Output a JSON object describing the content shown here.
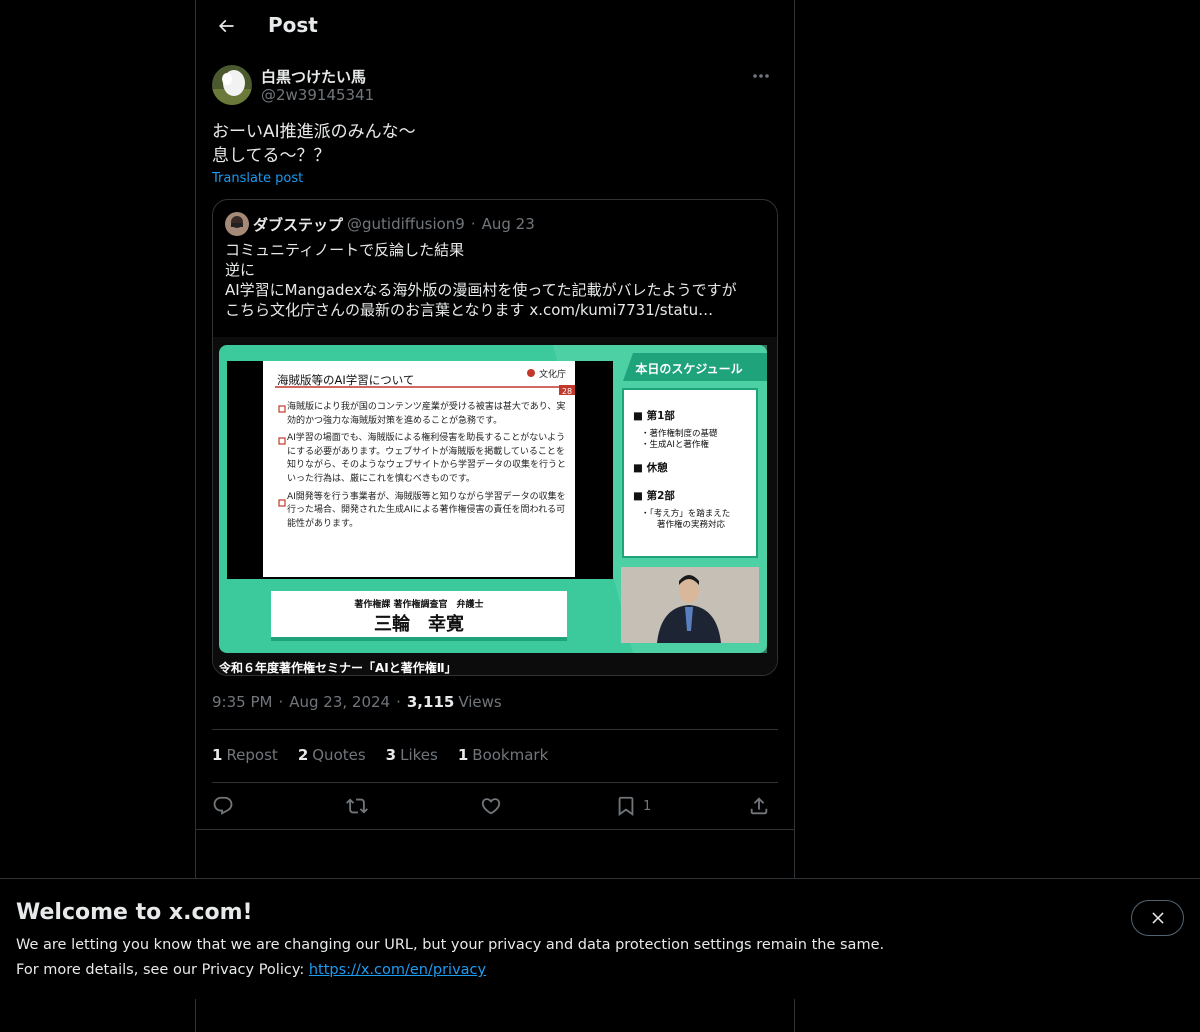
{
  "header": {
    "title": "Post"
  },
  "author": {
    "name": "白黒つけたい馬",
    "handle": "@2w39145341"
  },
  "post": {
    "text": "おーいAI推進派のみんな〜\n息してる〜？？",
    "translate_label": "Translate post"
  },
  "quote": {
    "name": "ダブステップ",
    "handle": "@gutidiffusion9",
    "dot": "·",
    "date": "Aug 23",
    "text": "コミュニティノートで反論した結果\n逆に\nAI学習にMangadexなる海外版の漫画村を使ってた記載がバレたようですが\nこちら文化庁さんの最新のお言葉となります  x.com/kumi7731/statu…",
    "media": {
      "slide_title": "海賊版等のAI学習について",
      "slide_logo": "文化庁",
      "slide_page": "28",
      "slide_bullets": [
        "海賊版により我が国のコンテンツ産業が受ける被害は甚大であり、実効的かつ強力な海賊版対策を進めることが急務です。",
        "AI学習の場面でも、海賊版による権利侵害を助長することがないようにする必要があります。ウェブサイトが海賊版を掲載していることを知りながら、そのようなウェブサイトから学習データの収集を行うといった行為は、厳にこれを慎むべきものです。",
        "AI開発等を行う事業者が、海賊版等と知りながら学習データの収集を行った場合、開発された生成AIによる著作権侵害の責任を問われる可能性があります。"
      ],
      "schedule_title": "本日のスケジュール",
      "schedule_part1": "■ 第1部",
      "schedule_part1_items": [
        "・著作権制度の基礎",
        "・生成AIと著作権"
      ],
      "schedule_break": "■ 休憩",
      "schedule_part2": "■ 第2部",
      "schedule_part2_items": [
        "・「考え方」を踏まえた",
        "著作権の実務対応"
      ],
      "speaker_role": "著作権課 著作権調査官　弁護士",
      "speaker_name": "三輪　幸寛",
      "caption": "令和６年度著作権セミナー「AIと著作権Ⅱ」"
    }
  },
  "meta": {
    "time": "9:35 PM",
    "dot1": "·",
    "date": "Aug 23, 2024",
    "dot2": "·",
    "views_count": "3,115",
    "views_label": "Views"
  },
  "stats": {
    "reposts_count": "1",
    "reposts_label": "Repost",
    "quotes_count": "2",
    "quotes_label": "Quotes",
    "likes_count": "3",
    "likes_label": "Likes",
    "bookmarks_count": "1",
    "bookmarks_label": "Bookmark"
  },
  "actions": {
    "bookmark_count": "1",
    "icons": [
      "reply-icon",
      "repost-icon",
      "like-icon",
      "bookmark-icon",
      "share-icon"
    ]
  },
  "banner": {
    "title": "Welcome to x.com!",
    "line1": "We are letting you know that we are changing our URL, but your privacy and data protection settings remain the same.",
    "line2_prefix": "For more details, see our Privacy Policy: ",
    "link": "https://x.com/en/privacy"
  },
  "colors": {
    "background": "#000000",
    "text": "#e7e9ea",
    "muted": "#71767b",
    "accent": "#1d9bf0",
    "border": "#2f3336",
    "slide_green": "#3cc99b"
  }
}
